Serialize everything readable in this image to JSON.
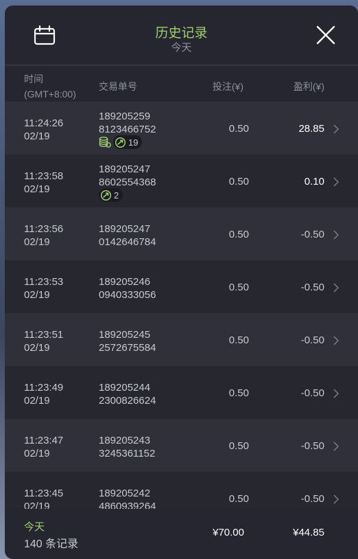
{
  "header": {
    "title": "历史记录",
    "subtitle": "今天",
    "calendar_icon": "calendar-icon",
    "close_icon": "close-icon"
  },
  "columns": {
    "time_label": "时间",
    "timezone_label": "(GMT+8:00)",
    "order_label": "交易单号",
    "bet_label": "投注(¥)",
    "profit_label": "盈利(¥)"
  },
  "rows": [
    {
      "time": "11:24:26",
      "date": "02/19",
      "order_line1": "189205259",
      "order_line2": "8123466752",
      "bet": "0.50",
      "profit": "28.85",
      "badge_count": "19"
    },
    {
      "time": "11:23:58",
      "date": "02/19",
      "order_line1": "189205247",
      "order_line2": "8602554368",
      "bet": "0.50",
      "profit": "0.10",
      "badge_count": "2"
    },
    {
      "time": "11:23:56",
      "date": "02/19",
      "order_line1": "189205247",
      "order_line2": "0142646784",
      "bet": "0.50",
      "profit": "-0.50"
    },
    {
      "time": "11:23:53",
      "date": "02/19",
      "order_line1": "189205246",
      "order_line2": "0940333056",
      "bet": "0.50",
      "profit": "-0.50"
    },
    {
      "time": "11:23:51",
      "date": "02/19",
      "order_line1": "189205245",
      "order_line2": "2572675584",
      "bet": "0.50",
      "profit": "-0.50"
    },
    {
      "time": "11:23:49",
      "date": "02/19",
      "order_line1": "189205244",
      "order_line2": "2300826624",
      "bet": "0.50",
      "profit": "-0.50"
    },
    {
      "time": "11:23:47",
      "date": "02/19",
      "order_line1": "189205243",
      "order_line2": "3245361152",
      "bet": "0.50",
      "profit": "-0.50"
    },
    {
      "time": "11:23:45",
      "date": "02/19",
      "order_line1": "189205242",
      "order_line2": "4860939264",
      "bet": "0.50",
      "profit": "-0.50"
    }
  ],
  "footer": {
    "period": "今天",
    "record_count": "140 条记录",
    "total_bet": "¥70.00",
    "total_profit": "¥44.85"
  },
  "colors": {
    "accent_green": "#9fcf6e",
    "panel_bg": "#25262f",
    "row_odd": "#2f3039",
    "row_even": "#27282f"
  }
}
